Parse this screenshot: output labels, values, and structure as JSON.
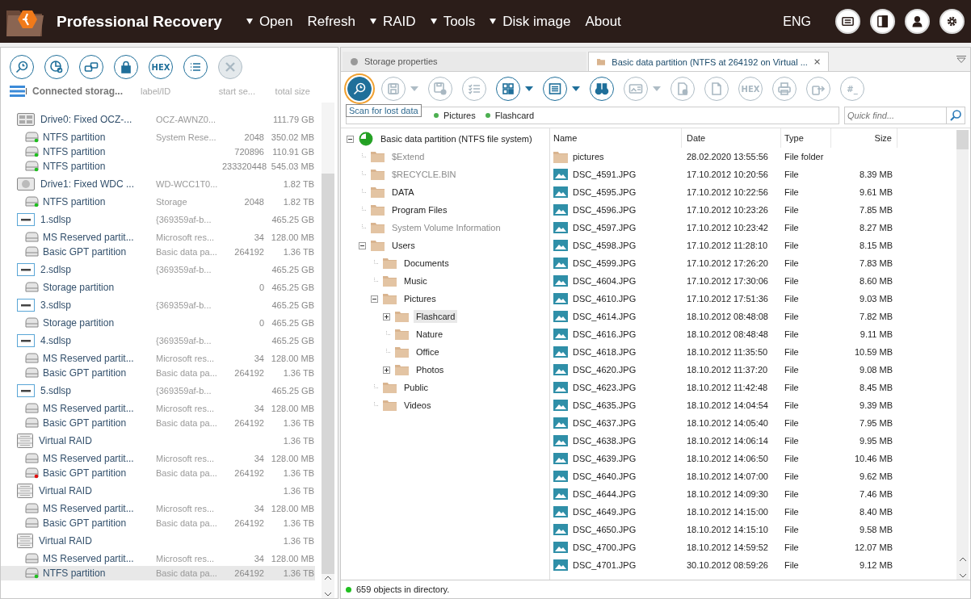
{
  "app": {
    "title": "Professional Recovery"
  },
  "menu": [
    {
      "label": "Open",
      "dropdown": true
    },
    {
      "label": "Refresh",
      "dropdown": false
    },
    {
      "label": "RAID",
      "dropdown": true
    },
    {
      "label": "Tools",
      "dropdown": true
    },
    {
      "label": "Disk image",
      "dropdown": true
    },
    {
      "label": "About",
      "dropdown": false
    }
  ],
  "language": "ENG",
  "header_buttons": [
    {
      "kind": "card"
    },
    {
      "kind": "panel"
    },
    {
      "kind": "person"
    },
    {
      "kind": "settings"
    }
  ],
  "left_toolbar": [
    {
      "kind": "search",
      "disabled": false
    },
    {
      "kind": "pie-chart",
      "disabled": false
    },
    {
      "kind": "drives",
      "disabled": false
    },
    {
      "kind": "lock",
      "disabled": false
    },
    {
      "kind": "hex",
      "label": "HEX",
      "disabled": false
    },
    {
      "kind": "list",
      "disabled": false
    },
    {
      "kind": "close",
      "disabled": true
    }
  ],
  "storage_columns": [
    "Connected storag...",
    "label/ID",
    "start se...",
    "total size"
  ],
  "storages": [
    {
      "kind": "ssd",
      "name": "Drive0: Fixed OCZ-...",
      "label": "OCZ-AWNZ0...",
      "size": "111.79 GB",
      "selected": false
    },
    {
      "kind": "partition",
      "name": "NTFS partition",
      "label": "System Rese...",
      "start": "2048",
      "size": "350.02 MB",
      "color": "#1fc01f",
      "selected": false
    },
    {
      "kind": "partition",
      "name": "NTFS partition",
      "start": "720896",
      "size": "110.91 GB",
      "color": "#1fc01f",
      "selected": false
    },
    {
      "kind": "partition",
      "name": "NTFS partition",
      "start": "233320448",
      "size": "545.03 MB",
      "color": "#1fc01f",
      "selected": false
    },
    {
      "kind": "hdd",
      "name": "Drive1: Fixed WDC ...",
      "label": "WD-WCC1T0...",
      "size": "1.82 TB",
      "selected": false
    },
    {
      "kind": "partition",
      "name": "NTFS partition",
      "label": "Storage",
      "start": "2048",
      "size": "1.82 TB",
      "color": "#1fc01f",
      "selected": false
    },
    {
      "kind": "image",
      "name": "1.sdlsp",
      "label": "{369359af-b...",
      "size": "465.25 GB",
      "selected": false
    },
    {
      "kind": "partition",
      "name": "MS Reserved partit...",
      "label": "Microsoft res...",
      "start": "34",
      "size": "128.00 MB",
      "selected": false
    },
    {
      "kind": "partition",
      "name": "Basic GPT partition",
      "label": "Basic data pa...",
      "start": "264192",
      "size": "1.36 TB",
      "selected": false
    },
    {
      "kind": "image",
      "name": "2.sdlsp",
      "label": "{369359af-b...",
      "size": "465.25 GB",
      "selected": false
    },
    {
      "kind": "partition",
      "name": "Storage partition",
      "start": "0",
      "size": "465.25 GB",
      "selected": false
    },
    {
      "kind": "image",
      "name": "3.sdlsp",
      "label": "{369359af-b...",
      "size": "465.25 GB",
      "selected": false
    },
    {
      "kind": "partition",
      "name": "Storage partition",
      "start": "0",
      "size": "465.25 GB",
      "selected": false
    },
    {
      "kind": "image",
      "name": "4.sdlsp",
      "label": "{369359af-b...",
      "size": "465.25 GB",
      "selected": false
    },
    {
      "kind": "partition",
      "name": "MS Reserved partit...",
      "label": "Microsoft res...",
      "start": "34",
      "size": "128.00 MB",
      "selected": false
    },
    {
      "kind": "partition",
      "name": "Basic GPT partition",
      "label": "Basic data pa...",
      "start": "264192",
      "size": "1.36 TB",
      "selected": false
    },
    {
      "kind": "image",
      "name": "5.sdlsp",
      "label": "{369359af-b...",
      "size": "465.25 GB",
      "selected": false
    },
    {
      "kind": "partition",
      "name": "MS Reserved partit...",
      "label": "Microsoft res...",
      "start": "34",
      "size": "128.00 MB",
      "selected": false
    },
    {
      "kind": "partition",
      "name": "Basic GPT partition",
      "label": "Basic data pa...",
      "start": "264192",
      "size": "1.36 TB",
      "selected": false
    },
    {
      "kind": "raid",
      "name": "Virtual RAID",
      "size": "1.36 TB",
      "selected": false
    },
    {
      "kind": "partition",
      "name": "MS Reserved partit...",
      "label": "Microsoft res...",
      "start": "34",
      "size": "128.00 MB",
      "selected": false
    },
    {
      "kind": "partition",
      "name": "Basic GPT partition",
      "label": "Basic data pa...",
      "start": "264192",
      "size": "1.36 TB",
      "color": "#e01010",
      "selected": false
    },
    {
      "kind": "raid",
      "name": "Virtual RAID",
      "size": "1.36 TB",
      "selected": false
    },
    {
      "kind": "partition",
      "name": "MS Reserved partit...",
      "label": "Microsoft res...",
      "start": "34",
      "size": "128.00 MB",
      "selected": false
    },
    {
      "kind": "partition",
      "name": "Basic GPT partition",
      "label": "Basic data pa...",
      "start": "264192",
      "size": "1.36 TB",
      "selected": false
    },
    {
      "kind": "raid",
      "name": "Virtual RAID",
      "size": "1.36 TB",
      "selected": false
    },
    {
      "kind": "partition",
      "name": "MS Reserved partit...",
      "label": "Microsoft res...",
      "start": "34",
      "size": "128.00 MB",
      "selected": false
    },
    {
      "kind": "partition",
      "name": "NTFS partition",
      "label": "Basic data pa...",
      "start": "264192",
      "size": "1.36 TB",
      "color": "#1fc01f",
      "selected": true
    }
  ],
  "tabs": [
    {
      "kind": "properties",
      "label": "Storage properties",
      "selected": false
    },
    {
      "kind": "folder",
      "label": "Basic data partition (NTFS at 264192 on Virtual ...",
      "selected": true
    }
  ],
  "right_toolbar": [
    {
      "kind": "scan",
      "disabled": false,
      "active": true
    },
    {
      "kind": "save",
      "disabled": true,
      "dropdown": true
    },
    {
      "kind": "save-settings",
      "disabled": true
    },
    {
      "kind": "checklist",
      "disabled": true
    },
    {
      "kind": "grid",
      "disabled": false,
      "dropdown": true
    },
    {
      "kind": "view",
      "disabled": false,
      "dropdown": true
    },
    {
      "kind": "find",
      "disabled": false
    },
    {
      "kind": "picture-view",
      "disabled": true,
      "dropdown": true
    },
    {
      "kind": "file-settings",
      "disabled": true
    },
    {
      "kind": "file",
      "disabled": true
    },
    {
      "kind": "hex",
      "label": "HEX",
      "disabled": true
    },
    {
      "kind": "print",
      "disabled": true
    },
    {
      "kind": "export",
      "disabled": true
    },
    {
      "kind": "hash",
      "label": "#_",
      "disabled": true
    }
  ],
  "tooltip": "Scan for lost data",
  "breadcrumb": [
    "Pictures",
    "Flashcard"
  ],
  "quick_find": {
    "placeholder": "Quick find..."
  },
  "tree": [
    {
      "kind": "partition",
      "label": "Basic data partition (NTFS file system)",
      "expandable": true,
      "expanded": true,
      "dimmed": false,
      "selected": false,
      "children": [
        {
          "kind": "folder",
          "label": "$Extend",
          "expandable": false,
          "dimmed": true,
          "selected": false
        },
        {
          "kind": "folder",
          "label": "$RECYCLE.BIN",
          "expandable": false,
          "dimmed": true,
          "selected": false
        },
        {
          "kind": "folder",
          "label": "DATA",
          "expandable": false,
          "dimmed": false,
          "selected": false
        },
        {
          "kind": "folder",
          "label": "Program Files",
          "expandable": false,
          "dimmed": false,
          "selected": false
        },
        {
          "kind": "folder",
          "label": "System Volume Information",
          "expandable": false,
          "dimmed": true,
          "selected": false
        },
        {
          "kind": "folder",
          "label": "Users",
          "expandable": true,
          "expanded": true,
          "dimmed": false,
          "selected": false,
          "children": [
            {
              "kind": "folder",
              "label": "Documents",
              "expandable": false,
              "dimmed": false,
              "selected": false
            },
            {
              "kind": "folder",
              "label": "Music",
              "expandable": false,
              "dimmed": false,
              "selected": false
            },
            {
              "kind": "folder",
              "label": "Pictures",
              "expandable": true,
              "expanded": true,
              "dimmed": false,
              "selected": false,
              "children": [
                {
                  "kind": "folder",
                  "label": "Flashcard",
                  "expandable": true,
                  "expanded": false,
                  "dimmed": false,
                  "selected": true
                },
                {
                  "kind": "folder",
                  "label": "Nature",
                  "expandable": false,
                  "dimmed": false,
                  "selected": false
                },
                {
                  "kind": "folder",
                  "label": "Office",
                  "expandable": false,
                  "dimmed": false,
                  "selected": false
                },
                {
                  "kind": "folder",
                  "label": "Photos",
                  "expandable": true,
                  "expanded": false,
                  "dimmed": false,
                  "selected": false
                }
              ]
            },
            {
              "kind": "folder",
              "label": "Public",
              "expandable": false,
              "dimmed": false,
              "selected": false
            },
            {
              "kind": "folder",
              "label": "Videos",
              "expandable": false,
              "dimmed": false,
              "selected": false
            }
          ]
        }
      ]
    }
  ],
  "file_columns": [
    "Name",
    "Date",
    "Type",
    "Size"
  ],
  "files": [
    {
      "kind": "folder",
      "name": "pictures",
      "date": "28.02.2020 13:55:56",
      "type": "File folder"
    },
    {
      "kind": "image",
      "name": "DSC_4591.JPG",
      "date": "17.10.2012 10:20:56",
      "type": "File",
      "size": "8.39 MB"
    },
    {
      "kind": "image",
      "name": "DSC_4595.JPG",
      "date": "17.10.2012 10:22:56",
      "type": "File",
      "size": "9.61 MB"
    },
    {
      "kind": "image",
      "name": "DSC_4596.JPG",
      "date": "17.10.2012 10:23:26",
      "type": "File",
      "size": "7.85 MB"
    },
    {
      "kind": "image",
      "name": "DSC_4597.JPG",
      "date": "17.10.2012 10:23:42",
      "type": "File",
      "size": "8.27 MB"
    },
    {
      "kind": "image",
      "name": "DSC_4598.JPG",
      "date": "17.10.2012 11:28:10",
      "type": "File",
      "size": "8.15 MB"
    },
    {
      "kind": "image",
      "name": "DSC_4599.JPG",
      "date": "17.10.2012 17:26:20",
      "type": "File",
      "size": "7.83 MB"
    },
    {
      "kind": "image",
      "name": "DSC_4604.JPG",
      "date": "17.10.2012 17:30:06",
      "type": "File",
      "size": "8.60 MB"
    },
    {
      "kind": "image",
      "name": "DSC_4610.JPG",
      "date": "17.10.2012 17:51:36",
      "type": "File",
      "size": "9.03 MB"
    },
    {
      "kind": "image",
      "name": "DSC_4614.JPG",
      "date": "18.10.2012 08:48:08",
      "type": "File",
      "size": "7.82 MB"
    },
    {
      "kind": "image",
      "name": "DSC_4616.JPG",
      "date": "18.10.2012 08:48:48",
      "type": "File",
      "size": "9.11 MB"
    },
    {
      "kind": "image",
      "name": "DSC_4618.JPG",
      "date": "18.10.2012 11:35:50",
      "type": "File",
      "size": "10.59 MB"
    },
    {
      "kind": "image",
      "name": "DSC_4620.JPG",
      "date": "18.10.2012 11:37:20",
      "type": "File",
      "size": "9.08 MB"
    },
    {
      "kind": "image",
      "name": "DSC_4623.JPG",
      "date": "18.10.2012 11:42:48",
      "type": "File",
      "size": "8.45 MB"
    },
    {
      "kind": "image",
      "name": "DSC_4635.JPG",
      "date": "18.10.2012 14:04:54",
      "type": "File",
      "size": "9.39 MB"
    },
    {
      "kind": "image",
      "name": "DSC_4637.JPG",
      "date": "18.10.2012 14:05:40",
      "type": "File",
      "size": "7.95 MB"
    },
    {
      "kind": "image",
      "name": "DSC_4638.JPG",
      "date": "18.10.2012 14:06:14",
      "type": "File",
      "size": "9.95 MB"
    },
    {
      "kind": "image",
      "name": "DSC_4639.JPG",
      "date": "18.10.2012 14:06:50",
      "type": "File",
      "size": "10.46 MB"
    },
    {
      "kind": "image",
      "name": "DSC_4640.JPG",
      "date": "18.10.2012 14:07:00",
      "type": "File",
      "size": "9.62 MB"
    },
    {
      "kind": "image",
      "name": "DSC_4644.JPG",
      "date": "18.10.2012 14:09:30",
      "type": "File",
      "size": "7.46 MB"
    },
    {
      "kind": "image",
      "name": "DSC_4649.JPG",
      "date": "18.10.2012 14:15:00",
      "type": "File",
      "size": "8.40 MB"
    },
    {
      "kind": "image",
      "name": "DSC_4650.JPG",
      "date": "18.10.2012 14:15:10",
      "type": "File",
      "size": "9.58 MB"
    },
    {
      "kind": "image",
      "name": "DSC_4700.JPG",
      "date": "18.10.2012 14:59:52",
      "type": "File",
      "size": "12.07 MB"
    },
    {
      "kind": "image",
      "name": "DSC_4701.JPG",
      "date": "30.10.2012 08:59:26",
      "type": "File",
      "size": "9.12 MB"
    }
  ],
  "status_bar": {
    "text": "659 objects in directory.",
    "ok": true
  }
}
